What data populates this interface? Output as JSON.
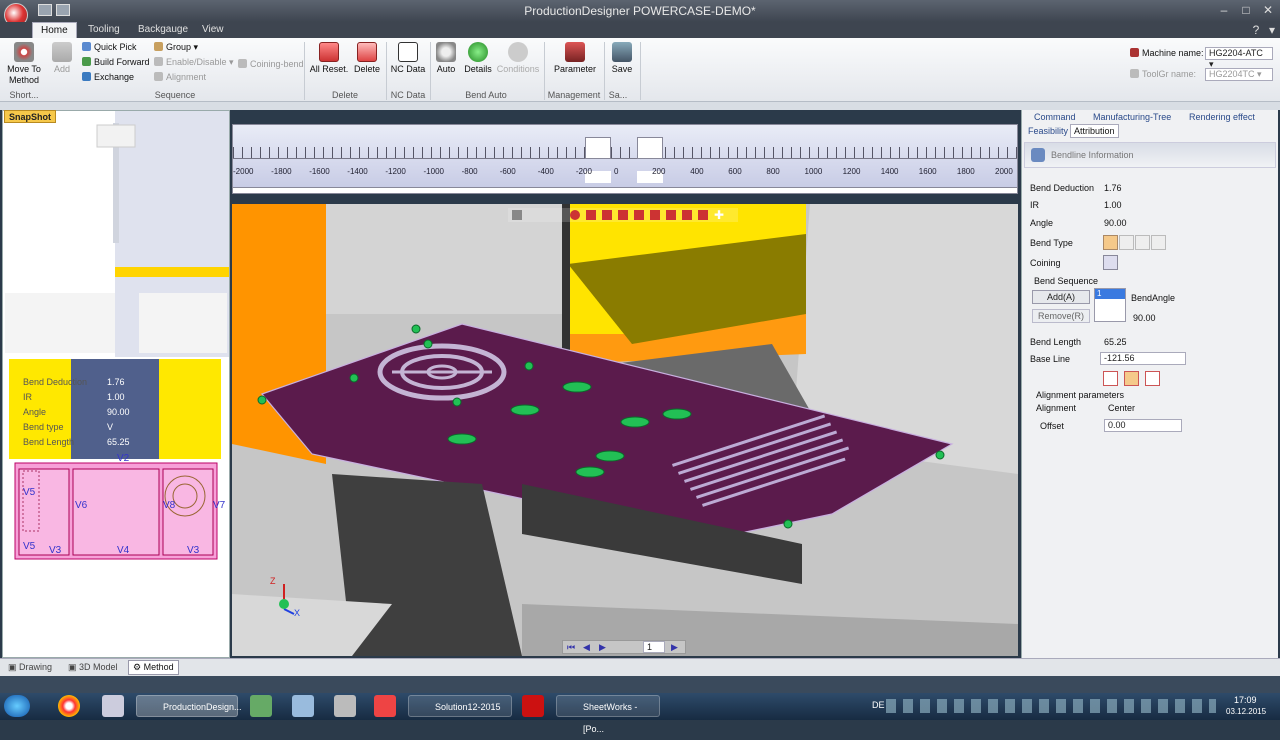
{
  "window": {
    "title": "ProductionDesigner  POWERCASE-DEMO*"
  },
  "tabs": [
    "Home",
    "Tooling",
    "Backgauge",
    "View"
  ],
  "ribbon": {
    "move_to_method": "Move To Method",
    "add": "Add",
    "quick_pick": "Quick Pick",
    "build_forward": "Build Forward",
    "exchange": "Exchange",
    "group": "Group",
    "enable_disable": "Enable/Disable",
    "alignment": "Alignment",
    "coining_bend": "Coining-bend",
    "all_reset": "All Reset.",
    "delete": "Delete",
    "nc_data": "NC Data",
    "auto": "Auto",
    "details": "Details",
    "conditions": "Conditions",
    "parameter": "Parameter",
    "save": "Save",
    "groups": {
      "short": "Short...",
      "sequence": "Sequence",
      "delete": "Delete",
      "nc_data": "NC Data",
      "bend_auto": "Bend Auto",
      "management": "Management",
      "sa": "Sa..."
    },
    "machine_name_label": "Machine name:",
    "machine_name_value": "HG2204-ATC",
    "toolgr_label": "ToolGr name:",
    "toolgr_value": "HG2204TC"
  },
  "snapshot": {
    "label": "SnapShot"
  },
  "snapshot_info": {
    "rows": [
      {
        "label": "Bend Deduction",
        "value": "1.76"
      },
      {
        "label": "IR",
        "value": "1.00"
      },
      {
        "label": "Angle",
        "value": "90.00"
      },
      {
        "label": "Bend type",
        "value": "V"
      },
      {
        "label": "Bend Length",
        "value": "65.25"
      }
    ],
    "views": [
      "V2",
      "V5",
      "V6",
      "V8",
      "V7",
      "V5",
      "V3",
      "V4",
      "V3"
    ]
  },
  "ruler": {
    "ticks": [
      "-2000",
      "-1800",
      "-1600",
      "-1400",
      "-1200",
      "-1000",
      "-800",
      "-600",
      "-400",
      "-200",
      "0",
      "200",
      "400",
      "600",
      "800",
      "1000",
      "1200",
      "1400",
      "1600",
      "1800",
      "2000"
    ]
  },
  "viewport": {
    "page_value": "1",
    "axis": [
      "Z",
      "X"
    ]
  },
  "right_panel": {
    "tabs": [
      "Command",
      "Manufacturing-Tree",
      "Rendering effect"
    ],
    "subtabs": [
      "Feasibility",
      "Attribution"
    ],
    "header": "Bendline Information",
    "fields": [
      {
        "label": "Bend Deduction",
        "value": "1.76"
      },
      {
        "label": "IR",
        "value": "1.00"
      },
      {
        "label": "Angle",
        "value": "90.00"
      }
    ],
    "bend_type_label": "Bend Type",
    "coining_label": "Coining",
    "bend_sequence_label": "Bend Sequence",
    "add_button": "Add(A)",
    "remove_button": "Remove(R)",
    "seq_item": "1",
    "bend_angle_label": "BendAngle",
    "bend_angle_value": "90.00",
    "bend_length_label": "Bend Length",
    "bend_length_value": "65.25",
    "base_line_label": "Base Line",
    "base_line_value": "-121.56",
    "alignment_params_label": "Alignment parameters",
    "alignment_label": "Alignment",
    "alignment_value": "Center",
    "offset_label": "Offset",
    "offset_value": "0.00"
  },
  "status": {
    "tabs": [
      "Drawing",
      "3D Model",
      "Method"
    ]
  },
  "taskbar": {
    "items": [
      "ProductionDesign...",
      "Solution12-2015",
      "SheetWorks - [Po..."
    ],
    "lang": "DE",
    "time": "17:09",
    "date": "03.12.2015"
  },
  "colors": {
    "sheet": "#5a1a4a",
    "tool_yellow": "#ffe000",
    "tool_orange": "#ff8a00",
    "embossed": "#22c055",
    "pink_view": "#f7a0d8"
  }
}
